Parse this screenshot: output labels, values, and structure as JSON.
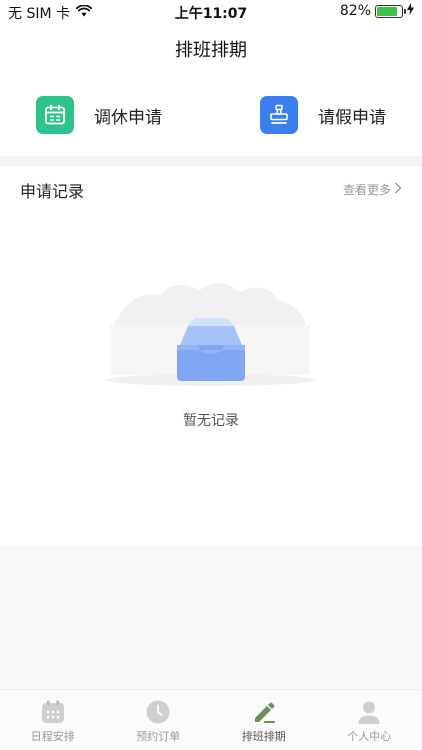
{
  "status_bar": {
    "carrier": "无 SIM 卡",
    "time": "上午11:07",
    "battery_percent": "82%",
    "battery_level": 0.82,
    "wifi_icon": "wifi-icon",
    "charging_icon": "charging-bolt-icon"
  },
  "nav": {
    "title": "排班排期"
  },
  "actions": [
    {
      "label": "调休申请",
      "icon": "calendar-icon",
      "color": "#2cc48b"
    },
    {
      "label": "请假申请",
      "icon": "stamp-icon",
      "color": "#3a7ef0"
    }
  ],
  "records": {
    "title": "申请记录",
    "more_label": "查看更多",
    "more_icon": "chevron-right-icon",
    "empty_text": "暂无记录",
    "empty_icon": "empty-inbox-illustration"
  },
  "tabbar": {
    "items": [
      {
        "label": "日程安排",
        "icon": "calendar-grid-icon",
        "active": false
      },
      {
        "label": "预约订单",
        "icon": "clock-icon",
        "active": false
      },
      {
        "label": "排班排期",
        "icon": "pencil-icon",
        "active": true
      },
      {
        "label": "个人中心",
        "icon": "user-icon",
        "active": false
      }
    ],
    "active_color": "#6b8f5a",
    "inactive_color": "#cfcfcf"
  }
}
